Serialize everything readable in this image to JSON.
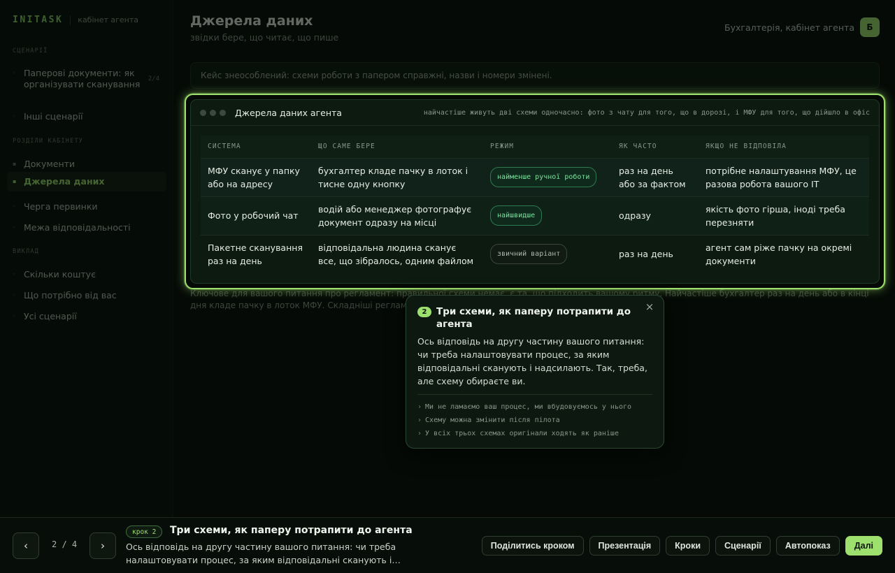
{
  "sidebar": {
    "brand": "INITASK",
    "brand_sub": "кабінет агента",
    "sections": [
      {
        "label": "СЦЕНАРІЇ",
        "items": [
          {
            "label": "Паперові документи: як організувати сканування",
            "count": "2/4"
          },
          {
            "label": "Інші сценарії"
          }
        ]
      },
      {
        "label": "РОЗДІЛИ КАБІНЕТУ",
        "items": [
          {
            "label": "Документи"
          },
          {
            "label": "Джерела даних",
            "active": true
          },
          {
            "label": "Черга первинки"
          },
          {
            "label": "Межа відповідальності"
          }
        ]
      },
      {
        "label": "ВИКЛАД",
        "items": [
          {
            "label": "Скільки коштує"
          },
          {
            "label": "Що потрібно від вас"
          },
          {
            "label": "Усі сценарії"
          }
        ]
      }
    ]
  },
  "header": {
    "title": "Джерела даних",
    "subtitle": "звідки бере, що читає, що пише",
    "org_name": "Бухгалтерія, кабінет агента",
    "org_badge": "Б"
  },
  "notice": "Кейс знеособлений: схеми роботи з папером справжні, назви і номери змінені.",
  "below_text": "Ключове для вашого питання про регламент: правильної схеми немає, є та, що підходить вашому ритму. Найчастіше бухгалтер раз на день або в кінці дня кладе пачку в лоток МФУ. Складніші регламенти люди не виконують.",
  "panel": {
    "title": "Джерела даних агента",
    "note": "найчастіше живуть дві схеми одночасно: фото з чату для того, що в дорозі, і МФУ для того, що дійшло в офіс",
    "columns": [
      "СИСТЕМА",
      "ЩО САМЕ БЕРЕ",
      "РЕЖИМ",
      "ЯК ЧАСТО",
      "ЯКЩО НЕ ВІДПОВІЛА"
    ],
    "rows": [
      {
        "system": "МФУ сканує у папку або на адресу",
        "takes": "бухгалтер кладе пачку в лоток і тисне одну кнопку",
        "mode": "найменше ручної роботи",
        "mode_style": "green",
        "freq": "раз на день або за фактом",
        "fallback": "потрібне налаштування МФУ, це разова робота вашого IT"
      },
      {
        "system": "Фото у робочий чат",
        "takes": "водій або менеджер фотографує документ одразу на місці",
        "mode": "найшвидше",
        "mode_style": "green",
        "freq": "одразу",
        "fallback": "якість фото гірша, іноді треба перезняти"
      },
      {
        "system": "Пакетне сканування раз на день",
        "takes": "відповідальна людина сканує все, що зібралось, одним файлом",
        "mode": "звичний варіант",
        "mode_style": "gray",
        "freq": "раз на день",
        "fallback": "агент сам ріже пачку на окремі документи"
      }
    ]
  },
  "popover": {
    "step_number": "2",
    "title": "Три схеми, як паперу потрапити до агента",
    "close_icon": "×",
    "body": "Ось відповідь на другу частину вашого питання: чи треба налаштовувати процес, за яким відповідальні сканують і надсилають. Так, треба, але схему обираєте ви.",
    "bullets": [
      "Ми не ламаємо ваш процес, ми вбудовуємось у нього",
      "Схему можна змінити після пілота",
      "У всіх трьох схемах оригінали ходять як раніше"
    ]
  },
  "bottom_bar": {
    "prev_icon": "‹",
    "next_icon": "›",
    "counter": "2 / 4",
    "step_badge": "крок 2",
    "step_title": "Три схеми, як паперу потрапити до агента",
    "step_desc": "Ось відповідь на другу частину вашого питання: чи треба налаштовувати процес, за яким відповідальні сканують і…",
    "actions": [
      "Поділитись кроком",
      "Презентація",
      "Кроки",
      "Сценарії",
      "Автопоказ"
    ],
    "primary_action": "Далі"
  },
  "colors": {
    "accent": "#9ee06e",
    "background": "#050a06",
    "panel": "#0c1a10",
    "pill_green": "#7fe0a0"
  }
}
